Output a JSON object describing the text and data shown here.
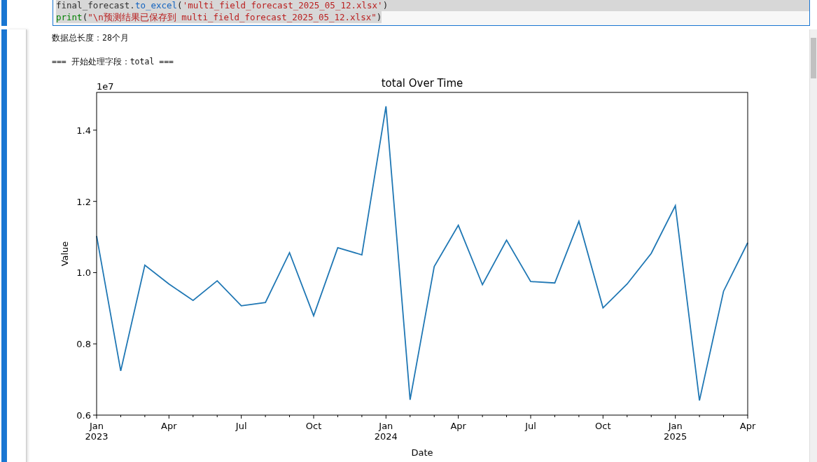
{
  "code_cell": {
    "lines": [
      {
        "selected": true,
        "segments": [
          {
            "kind": "name",
            "text": "final_forecast."
          },
          {
            "kind": "method",
            "text": "to_excel"
          },
          {
            "kind": "punct",
            "text": "("
          },
          {
            "kind": "string",
            "text": "'multi_field_forecast_2025_05_12.xlsx'"
          },
          {
            "kind": "punct",
            "text": ")"
          }
        ]
      },
      {
        "selected": true,
        "segments": [
          {
            "kind": "builtin",
            "text": "print"
          },
          {
            "kind": "punct",
            "text": "("
          },
          {
            "kind": "string",
            "text": "\"\\n预测结果已保存到 multi_field_forecast_2025_05_12.xlsx\""
          },
          {
            "kind": "punct",
            "text": ")"
          }
        ]
      }
    ]
  },
  "output": {
    "lines": [
      "数据总长度：28个月",
      "=== 开始处理字段：total ==="
    ],
    "chart_data": {
      "type": "line",
      "title": "total Over Time",
      "xlabel": "Date",
      "ylabel": "Value",
      "annotations": [
        {
          "text": "1e7"
        }
      ],
      "categories": [
        "Jan\n2023",
        null,
        null,
        "Apr",
        null,
        null,
        "Jul",
        null,
        null,
        "Oct",
        null,
        null,
        "Jan\n2024",
        null,
        null,
        "Apr",
        null,
        null,
        "Jul",
        null,
        null,
        "Oct",
        null,
        null,
        "Jan\n2025",
        null,
        null,
        "Apr"
      ],
      "series": [
        {
          "color": "#1f77b4",
          "values": [
            1.103,
            0.724,
            1.021,
            0.968,
            0.922,
            0.977,
            0.907,
            0.916,
            1.056,
            0.879,
            1.07,
            1.05,
            1.467,
            0.643,
            1.017,
            1.133,
            0.966,
            1.091,
            0.975,
            0.971,
            1.144,
            0.901,
            0.968,
            1.054,
            1.188,
            0.641,
            0.948,
            1.084
          ]
        }
      ],
      "ylim": [
        0.6,
        1.506
      ],
      "yticks": [
        {
          "value": 0.6,
          "label": "0.6"
        },
        {
          "value": 0.8,
          "label": "0.8"
        },
        {
          "value": 1.0,
          "label": "1.0"
        },
        {
          "value": 1.2,
          "label": "1.2"
        },
        {
          "value": 1.4,
          "label": "1.4"
        }
      ]
    }
  }
}
